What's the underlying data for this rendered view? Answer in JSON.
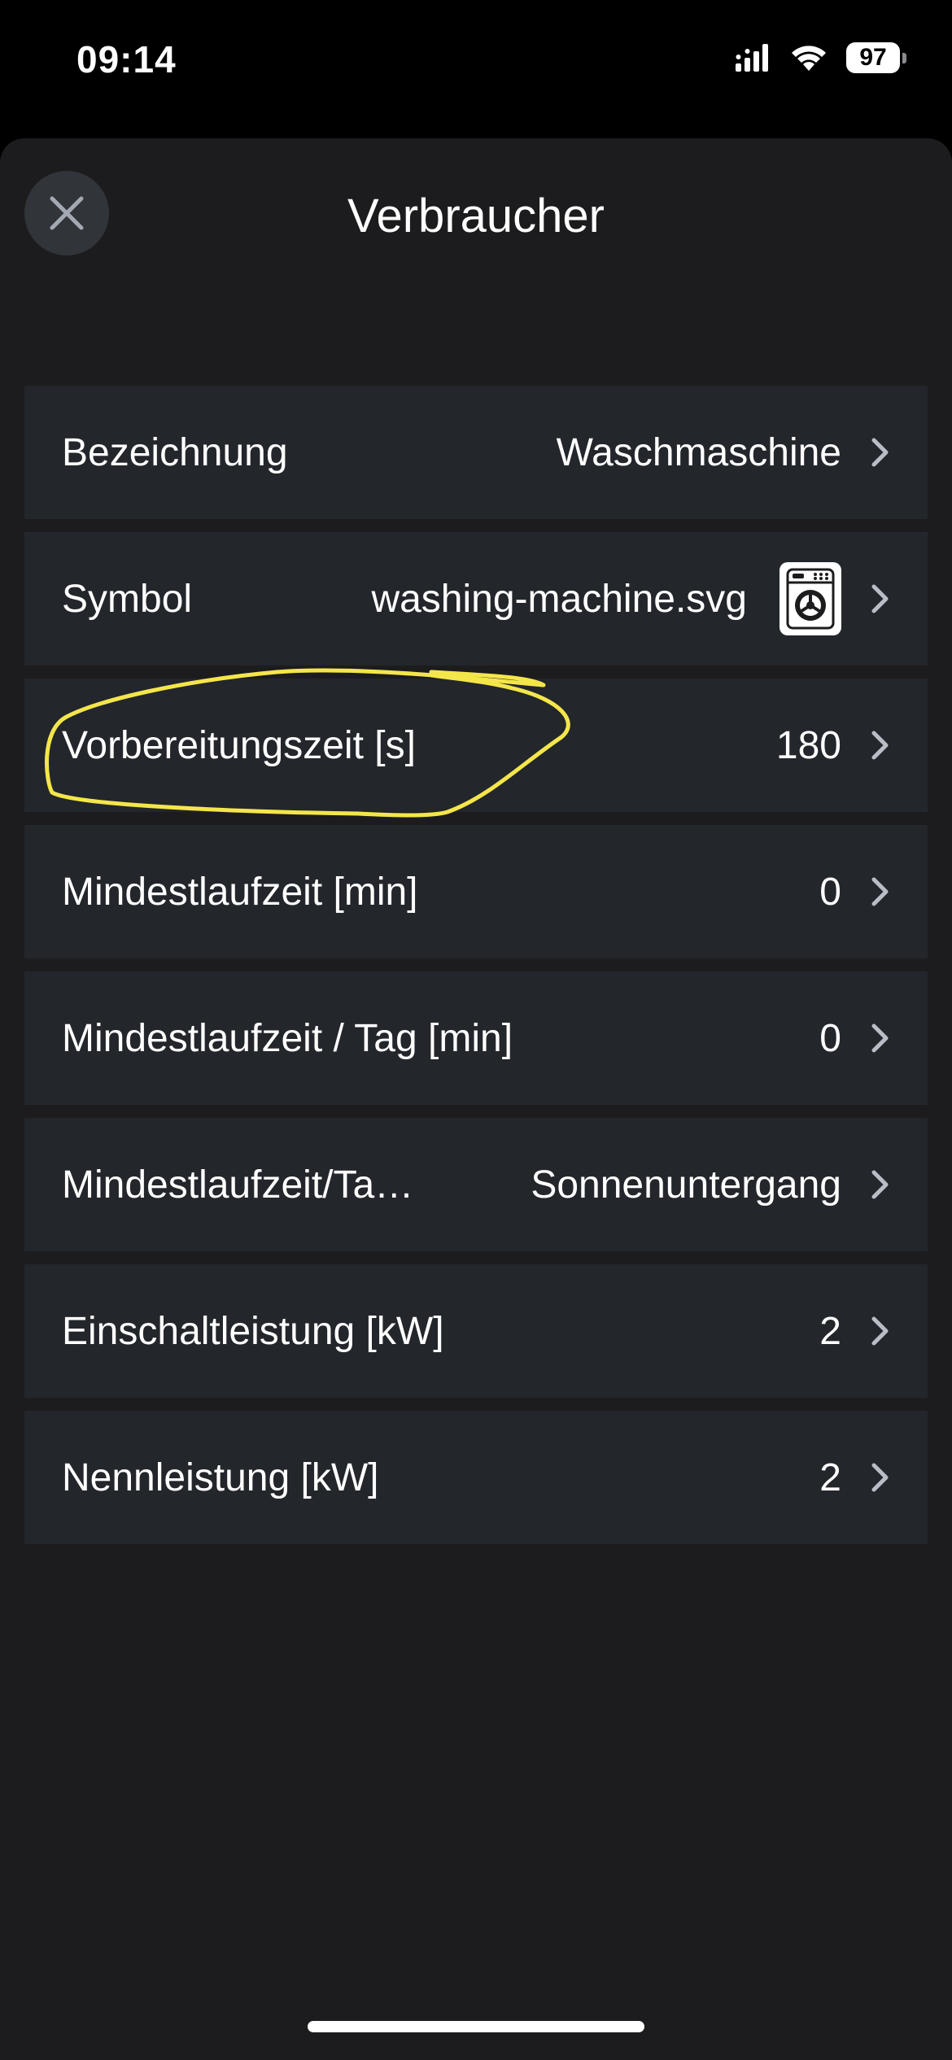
{
  "status_bar": {
    "time": "09:14",
    "battery_level": "97",
    "signal_icon": "cellular-signal-icon",
    "wifi_icon": "wifi-icon"
  },
  "sheet": {
    "title": "Verbraucher",
    "close_icon": "close-icon"
  },
  "rows": [
    {
      "label": "Bezeichnung",
      "value": "Waschmaschine"
    },
    {
      "label": "Symbol",
      "value": "washing-machine.svg",
      "icon": "washing-machine-icon"
    },
    {
      "label": "Vorbereitungszeit [s]",
      "value": "180"
    },
    {
      "label": "Mindestlaufzeit [min]",
      "value": "0"
    },
    {
      "label": "Mindestlaufzeit / Tag [min]",
      "value": "0"
    },
    {
      "label": "Mindestlaufzeit/Ta…",
      "value": "Sonnenuntergang"
    },
    {
      "label": "Einschaltleistung [kW]",
      "value": "2"
    },
    {
      "label": "Nennleistung [kW]",
      "value": "2"
    }
  ],
  "colors": {
    "background": "#000000",
    "sheet": "#1c1c1e",
    "row": "#23262b",
    "close_button": "#313438",
    "chevron": "#b8bdc6",
    "annotation": "#f4e64a"
  }
}
